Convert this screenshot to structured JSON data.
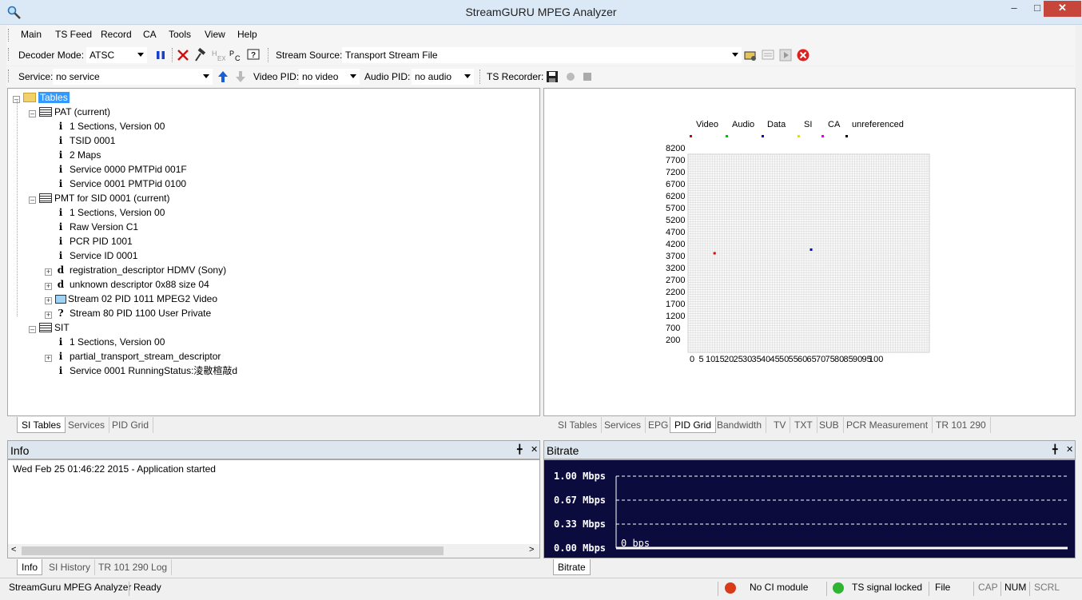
{
  "window": {
    "title": "StreamGURU MPEG Analyzer"
  },
  "menu": [
    "Main",
    "TS Feed",
    "Record",
    "CA",
    "Tools",
    "View",
    "Help"
  ],
  "toolbar": {
    "decoder_mode_label": "Decoder Mode:",
    "decoder_mode_value": "ATSC",
    "stream_source_label": "Stream Source:",
    "stream_source_value": "Transport Stream File",
    "service_label": "Service:",
    "service_value": "no service",
    "video_pid_label": "Video PID:",
    "video_pid_value": "no video",
    "audio_pid_label": "Audio PID:",
    "audio_pid_value": "no audio",
    "ts_recorder_label": "TS Recorder:"
  },
  "tree": {
    "root": "Tables",
    "items": [
      "PAT (current)",
      "1 Sections, Version 00",
      "TSID 0001",
      "2 Maps",
      "Service 0000 PMTPid 001F",
      "Service 0001 PMTPid 0100",
      "PMT for SID 0001 (current)",
      "1 Sections, Version 00",
      "Raw Version C1",
      "PCR PID 1001",
      "Service ID 0001",
      "registration_descriptor HDMV (Sony)",
      "unknown descriptor 0x88 size 04",
      "Stream 02 PID 1011 MPEG2 Video",
      "Stream 80 PID 1100 User Private",
      "SIT",
      "1 Sections, Version 00",
      "partial_transport_stream_descriptor",
      "Service 0001 RunningStatus:淩敭楦敲d"
    ]
  },
  "left_tabs": [
    "SI Tables",
    "Services",
    "PID Grid"
  ],
  "right_tabs": [
    "SI Tables",
    "Services",
    "EPG",
    "PID Grid",
    "Bandwidth",
    "TV",
    "TXT",
    "SUB",
    "PCR Measurement",
    "TR 101 290"
  ],
  "chart_data": {
    "type": "scatter",
    "legend": [
      {
        "name": "Video",
        "color": "#e00000"
      },
      {
        "name": "Audio",
        "color": "#00c000"
      },
      {
        "name": "Data",
        "color": "#0000e0"
      },
      {
        "name": "SI",
        "color": "#e0e000"
      },
      {
        "name": "CA",
        "color": "#e000e0"
      },
      {
        "name": "unreferenced",
        "color": "#000000"
      }
    ],
    "y_ticks": [
      "8200",
      "7700",
      "7200",
      "6700",
      "6200",
      "5700",
      "5200",
      "4700",
      "4200",
      "3700",
      "3200",
      "2700",
      "2200",
      "1700",
      "1200",
      "700",
      "200"
    ],
    "x_ticks": [
      "0",
      "5",
      "10",
      "15",
      "20",
      "25",
      "30",
      "35",
      "40",
      "45",
      "50",
      "55",
      "60",
      "65",
      "70",
      "75",
      "80",
      "85",
      "90",
      "95",
      "100"
    ],
    "xlim": [
      0,
      100
    ],
    "ylim": [
      0,
      8200
    ],
    "points": [
      {
        "x": 11,
        "y": 4100,
        "color": "#e00000"
      },
      {
        "x": 51,
        "y": 4250,
        "color": "#0000e0"
      }
    ]
  },
  "info": {
    "title": "Info",
    "log": "Wed Feb 25 01:46:22 2015 - Application started",
    "tabs": [
      "Info",
      "SI History",
      "TR 101 290 Log"
    ]
  },
  "bitrate": {
    "title": "Bitrate",
    "labels": [
      "1.00 Mbps",
      "0.67 Mbps",
      "0.33 Mbps",
      "0.00 Mbps"
    ],
    "current": "0 bps",
    "tab": "Bitrate"
  },
  "status": {
    "app": "StreamGuru MPEG Analyzer",
    "state": "Ready",
    "ci": "No CI module",
    "signal": "TS signal locked",
    "file": "File",
    "cap": "CAP",
    "num": "NUM",
    "scrl": "SCRL",
    "ci_led": "#d93a1a",
    "signal_led": "#2fb52f"
  }
}
